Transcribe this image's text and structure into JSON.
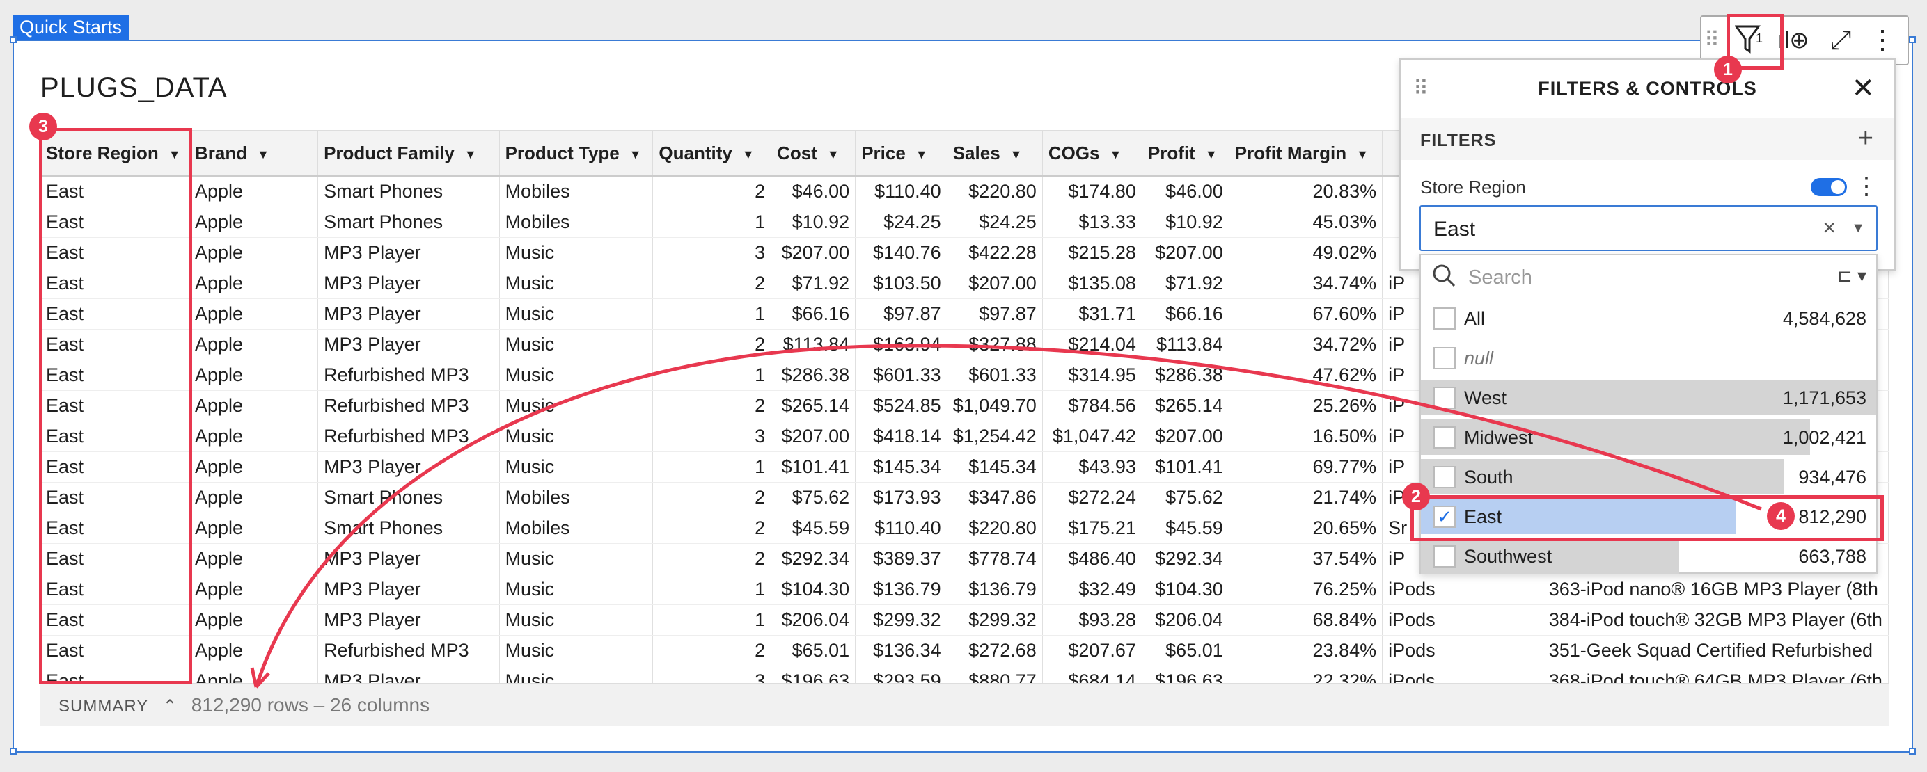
{
  "tag": "Quick Starts",
  "title": "PLUGS_DATA",
  "columns": [
    "Store Region",
    "Brand",
    "Product Family",
    "Product Type",
    "Quantity",
    "Cost",
    "Price",
    "Sales",
    "COGs",
    "Profit",
    "Profit Margin",
    "",
    ""
  ],
  "rows": [
    [
      "East",
      "Apple",
      "Smart Phones",
      "Mobiles",
      "2",
      "$46.00",
      "$110.40",
      "$220.80",
      "$174.80",
      "$46.00",
      "20.83%",
      "",
      ""
    ],
    [
      "East",
      "Apple",
      "Smart Phones",
      "Mobiles",
      "1",
      "$10.92",
      "$24.25",
      "$24.25",
      "$13.33",
      "$10.92",
      "45.03%",
      "",
      ""
    ],
    [
      "East",
      "Apple",
      "MP3 Player",
      "Music",
      "3",
      "$207.00",
      "$140.76",
      "$422.28",
      "$215.28",
      "$207.00",
      "49.02%",
      "",
      ""
    ],
    [
      "East",
      "Apple",
      "MP3 Player",
      "Music",
      "2",
      "$71.92",
      "$103.50",
      "$207.00",
      "$135.08",
      "$71.92",
      "34.74%",
      "iP",
      ""
    ],
    [
      "East",
      "Apple",
      "MP3 Player",
      "Music",
      "1",
      "$66.16",
      "$97.87",
      "$97.87",
      "$31.71",
      "$66.16",
      "67.60%",
      "iP",
      ""
    ],
    [
      "East",
      "Apple",
      "MP3 Player",
      "Music",
      "2",
      "$113.84",
      "$163.94",
      "$327.88",
      "$214.04",
      "$113.84",
      "34.72%",
      "iP",
      ""
    ],
    [
      "East",
      "Apple",
      "Refurbished MP3",
      "Music",
      "1",
      "$286.38",
      "$601.33",
      "$601.33",
      "$314.95",
      "$286.38",
      "47.62%",
      "iP",
      ""
    ],
    [
      "East",
      "Apple",
      "Refurbished MP3",
      "Music",
      "2",
      "$265.14",
      "$524.85",
      "$1,049.70",
      "$784.56",
      "$265.14",
      "25.26%",
      "iP",
      ""
    ],
    [
      "East",
      "Apple",
      "Refurbished MP3",
      "Music",
      "3",
      "$207.00",
      "$418.14",
      "$1,254.42",
      "$1,047.42",
      "$207.00",
      "16.50%",
      "iP",
      ""
    ],
    [
      "East",
      "Apple",
      "MP3 Player",
      "Music",
      "1",
      "$101.41",
      "$145.34",
      "$145.34",
      "$43.93",
      "$101.41",
      "69.77%",
      "iP",
      ""
    ],
    [
      "East",
      "Apple",
      "Smart Phones",
      "Mobiles",
      "2",
      "$75.62",
      "$173.93",
      "$347.86",
      "$272.24",
      "$75.62",
      "21.74%",
      "iP",
      ""
    ],
    [
      "East",
      "Apple",
      "Smart Phones",
      "Mobiles",
      "2",
      "$45.59",
      "$110.40",
      "$220.80",
      "$175.21",
      "$45.59",
      "20.65%",
      "Sr",
      ""
    ],
    [
      "East",
      "Apple",
      "MP3 Player",
      "Music",
      "2",
      "$292.34",
      "$389.37",
      "$778.74",
      "$486.40",
      "$292.34",
      "37.54%",
      "iP",
      ""
    ],
    [
      "East",
      "Apple",
      "MP3 Player",
      "Music",
      "1",
      "$104.30",
      "$136.79",
      "$136.79",
      "$32.49",
      "$104.30",
      "76.25%",
      "iPods",
      "363-iPod nano® 16GB MP3 Player (8th"
    ],
    [
      "East",
      "Apple",
      "MP3 Player",
      "Music",
      "1",
      "$206.04",
      "$299.32",
      "$299.32",
      "$93.28",
      "$206.04",
      "68.84%",
      "iPods",
      "384-iPod touch® 32GB MP3 Player (6th"
    ],
    [
      "East",
      "Apple",
      "Refurbished MP3",
      "Music",
      "2",
      "$65.01",
      "$136.34",
      "$272.68",
      "$207.67",
      "$65.01",
      "23.84%",
      "iPods",
      "351-Geek Squad Certified Refurbished"
    ],
    [
      "East",
      "Apple",
      "MP3 Player",
      "Music",
      "3",
      "$196.63",
      "$293.59",
      "$880.77",
      "$684.14",
      "$196.63",
      "22.32%",
      "iPods",
      "368-iPod touch® 64GB MP3 Player (6th"
    ]
  ],
  "summary": {
    "label": "SUMMARY",
    "rows": "812,290 rows – 26 columns"
  },
  "panel": {
    "title": "FILTERS & CONTROLS",
    "section": "FILTERS",
    "control_label": "Store Region",
    "selected_value": "East",
    "search_placeholder": "Search",
    "options": [
      {
        "name": "All",
        "count": "4,584,628",
        "bar": 0,
        "checked": false
      },
      {
        "name": "null",
        "count": "",
        "bar": 0,
        "checked": false
      },
      {
        "name": "West",
        "count": "1,171,653",
        "bar": 1.0,
        "checked": false
      },
      {
        "name": "Midwest",
        "count": "1,002,421",
        "bar": 0.855,
        "checked": false
      },
      {
        "name": "South",
        "count": "934,476",
        "bar": 0.798,
        "checked": false
      },
      {
        "name": "East",
        "count": "812,290",
        "bar": 0.693,
        "checked": true
      },
      {
        "name": "Southwest",
        "count": "663,788",
        "bar": 0.567,
        "checked": false
      }
    ]
  },
  "filter_badge_count": "1",
  "annotations": [
    "1",
    "2",
    "3",
    "4"
  ],
  "colors": {
    "accent": "#1f6fe5",
    "annotation": "#e8384f",
    "selected_row": "#b7cff2"
  }
}
